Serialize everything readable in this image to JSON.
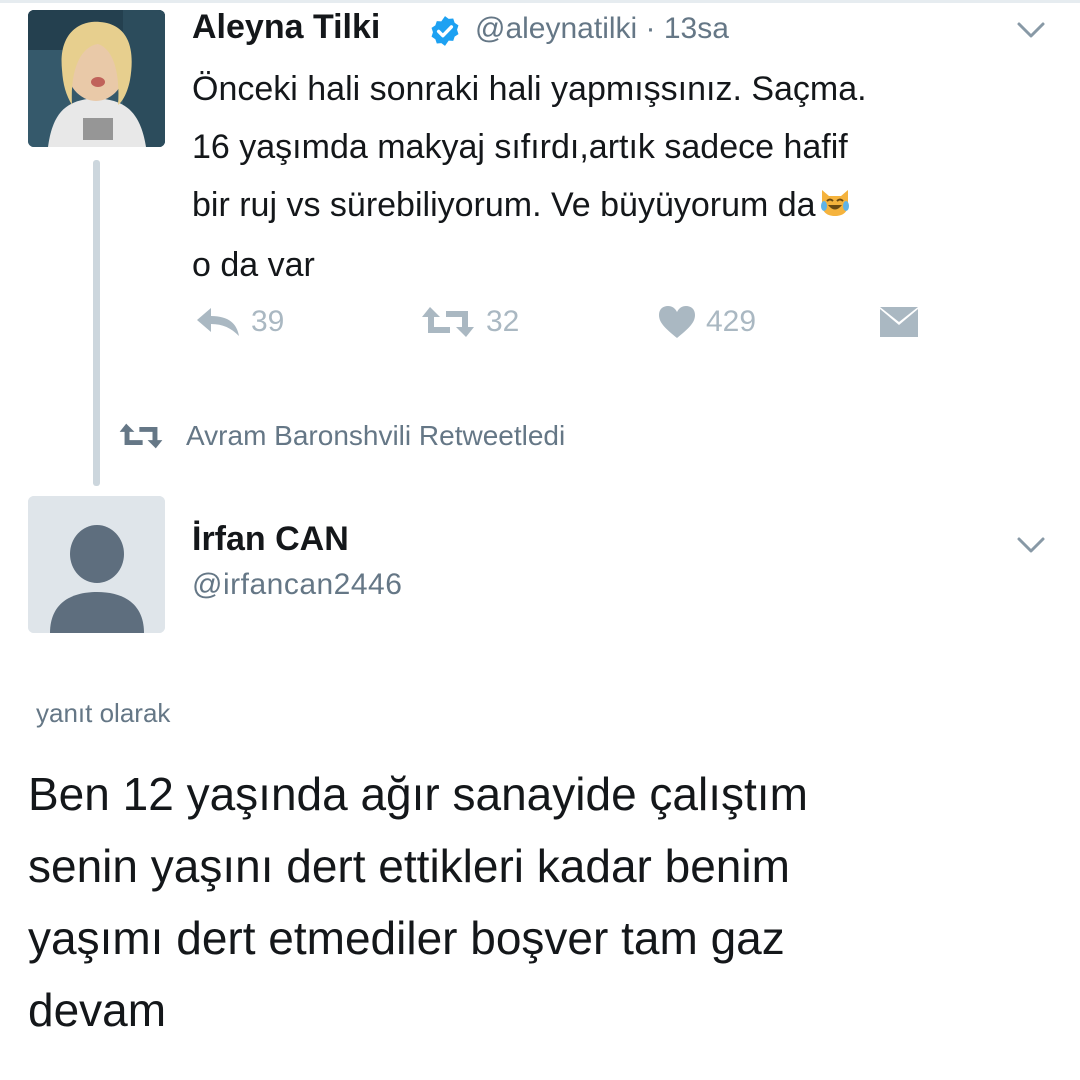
{
  "tweet1": {
    "author_name": "Aleyna Tilki",
    "handle_time": "@aleynatilki · 13sa",
    "text_lines": [
      "Önceki hali sonraki hali yapmışsınız. Saçma.",
      "16 yaşımda makyaj sıfırdı,artık sadece hafif",
      "bir ruj vs sürebiliyorum. Ve büyüyorum da",
      "o da var"
    ],
    "emoji": "grinning-cat-with-tears-of-joy",
    "actions": {
      "reply_count": "39",
      "retweet_count": "32",
      "like_count": "429"
    }
  },
  "retweet_notice": "Avram Baronshvili Retweetledi",
  "tweet2": {
    "author_name": "İrfan CAN",
    "handle": "@irfancan2446",
    "reply_label": "yanıt olarak",
    "text_lines": [
      "Ben 12 yaşında ağır sanayide çalıştım",
      "senin yaşını dert ettikleri kadar benim",
      "yaşımı dert etmediler boşver tam gaz",
      "devam"
    ]
  },
  "colors": {
    "text": "#14171a",
    "secondary": "#657786",
    "action_gray": "#aab8c2",
    "verified_blue": "#1da1f2",
    "thread_line": "#ccd6dd"
  }
}
